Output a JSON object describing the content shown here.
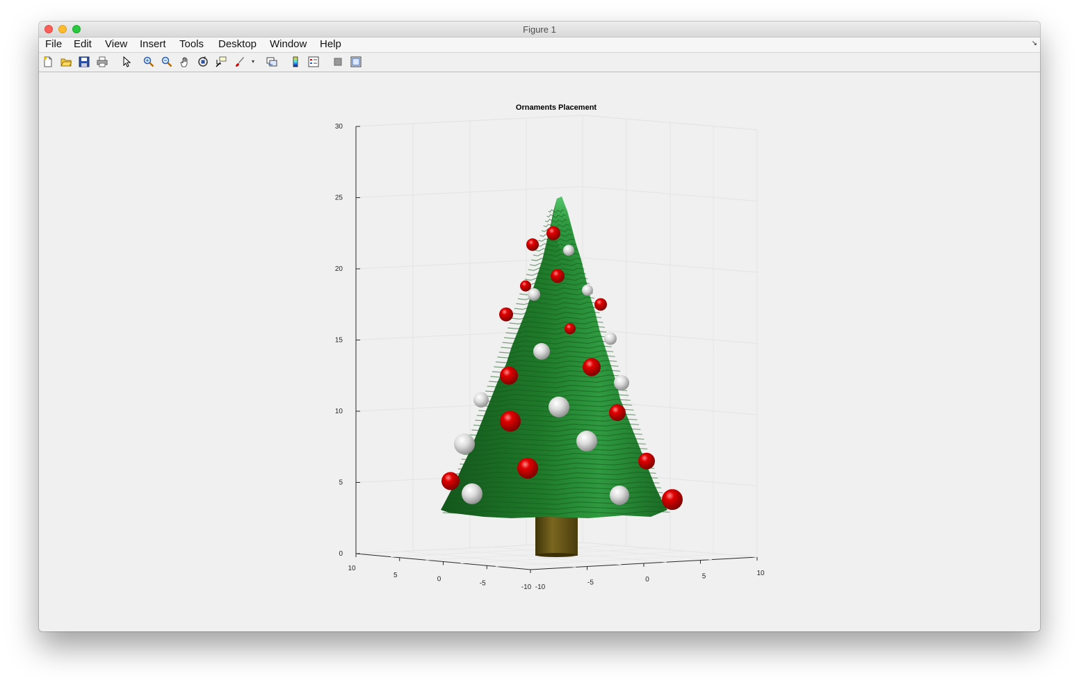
{
  "window": {
    "title": "Figure 1"
  },
  "menu": [
    "File",
    "Edit",
    "View",
    "Insert",
    "Tools",
    "Desktop",
    "Window",
    "Help"
  ],
  "toolbar": {
    "buttons": [
      "new-figure-icon",
      "open-file-icon",
      "save-icon",
      "print-icon",
      "pointer-icon",
      "zoom-in-icon",
      "zoom-out-icon",
      "pan-hand-icon",
      "rotate-3d-icon",
      "data-cursor-icon",
      "brush-icon",
      "link-plot-icon",
      "colorbar-icon",
      "legend-icon",
      "hide-plot-tools-icon",
      "show-plot-tools-icon"
    ]
  },
  "chart_data": {
    "type": "surface-3d",
    "title": "Ornaments Placement",
    "zlim": [
      0,
      30
    ],
    "z_ticks": [
      "0",
      "5",
      "10",
      "15",
      "20",
      "25",
      "30"
    ],
    "x_ticks": [
      "-10",
      "-5",
      "0",
      "5",
      "10"
    ],
    "y_ticks": [
      "10",
      "5",
      "0",
      "-5",
      "-10"
    ],
    "grid": true,
    "colors": {
      "foliage": "#1f7a2a",
      "foliage_light": "#3aa24c",
      "trunk": "#5a4a12",
      "ornament_red": "#d40000",
      "ornament_white": "#e6e6e6"
    },
    "tree": {
      "trunk_height": [
        0,
        3
      ],
      "foliage_z": [
        3,
        25
      ]
    },
    "ornaments": [
      {
        "color": "red",
        "z": 22.5
      },
      {
        "color": "red",
        "z": 21.7
      },
      {
        "color": "white",
        "z": 21.3
      },
      {
        "color": "red",
        "z": 19.5
      },
      {
        "color": "red",
        "z": 18.8
      },
      {
        "color": "white",
        "z": 18.2
      },
      {
        "color": "white",
        "z": 18.5
      },
      {
        "color": "red",
        "z": 17.5
      },
      {
        "color": "red",
        "z": 16.8
      },
      {
        "color": "red",
        "z": 15.8
      },
      {
        "color": "white",
        "z": 15.1
      },
      {
        "color": "white",
        "z": 14.2
      },
      {
        "color": "red",
        "z": 13.1
      },
      {
        "color": "red",
        "z": 12.5
      },
      {
        "color": "white",
        "z": 12.0
      },
      {
        "color": "white",
        "z": 10.8
      },
      {
        "color": "white",
        "z": 10.3
      },
      {
        "color": "red",
        "z": 9.9
      },
      {
        "color": "red",
        "z": 9.3
      },
      {
        "color": "white",
        "z": 7.7
      },
      {
        "color": "white",
        "z": 7.9
      },
      {
        "color": "red",
        "z": 6.5
      },
      {
        "color": "red",
        "z": 6.0
      },
      {
        "color": "red",
        "z": 5.1
      },
      {
        "color": "white",
        "z": 4.2
      },
      {
        "color": "white",
        "z": 4.1
      },
      {
        "color": "red",
        "z": 3.8
      }
    ]
  }
}
